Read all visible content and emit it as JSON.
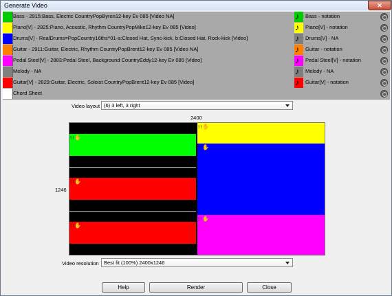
{
  "window": {
    "title": "Generate Video",
    "close_label": "✕"
  },
  "tracks": [
    {
      "color": "#00cc00",
      "label": "Bass - 2915:Bass, Electric CountryPopByron12-key Ev 085 [Video NA]",
      "icon_color": "#00cc00",
      "notation": "Bass - notation",
      "icon": "music-note-icon"
    },
    {
      "color": "#ffff00",
      "label": "Piano[V] - 2825:Piano, Acoustic, Rhythm CountryPopMike12-key Ev 085 [Video]",
      "icon_color": "#ffff00",
      "notation": "Piano[V] - notation",
      "icon": "music-note-icon"
    },
    {
      "color": "#0000ff",
      "label": "Drums[V] - RealDrums=PopCountry16ths^01-a:Closed Hat, Sync-kick, b:Closed Hat, Rock-kick [Video]",
      "icon_color": "#7f7f7f",
      "notation": "Drums[V] - NA",
      "icon": "music-note-icon"
    },
    {
      "color": "#ff8000",
      "label": "Guitar - 2911:Guitar, Electric, Rhythm CountryPopBrent12-key Ev 085 [Video NA]",
      "icon_color": "#ff8000",
      "notation": "Guitar - notation",
      "icon": "music-note-icon"
    },
    {
      "color": "#ff00ff",
      "label": "Pedal Steel[V] - 2883:Pedal Steel, Background CountryEddy12-key Ev 085 [Video]",
      "icon_color": "#ff00ff",
      "notation": "Pedal Steel[V] - notation",
      "icon": "music-note-icon"
    },
    {
      "color": "#808080",
      "label": "Melody - NA",
      "icon_color": "#7f7f7f",
      "notation": "Melody - NA",
      "icon": "music-note-icon"
    },
    {
      "color": "#ff0000",
      "label": "Guitar[V] - 2829:Guitar, Electric, Soloist CountryPopBrent12-key Ev 085 [Video]",
      "icon_color": "#ff0000",
      "notation": "Guitar[V] - notation",
      "icon": "music-note-icon"
    }
  ],
  "chord_sheet": {
    "color": "#ffffff",
    "label": "Chord Sheet"
  },
  "layout": {
    "label": "Video layout",
    "value": "(6) 3 left, 3 right"
  },
  "preview": {
    "width_label": "2400",
    "height_label": "1246",
    "handle_glyph": "↑↑✋"
  },
  "resolution": {
    "label": "Video resolution",
    "value": "Best fit (100%) 2400x1246"
  },
  "buttons": {
    "help": "Help",
    "render": "Render",
    "close": "Close"
  },
  "colors": {
    "green": "#00ff00",
    "yellow": "#ffff00",
    "blue": "#0000ff",
    "red": "#ff0000",
    "magenta": "#ff00ff"
  }
}
